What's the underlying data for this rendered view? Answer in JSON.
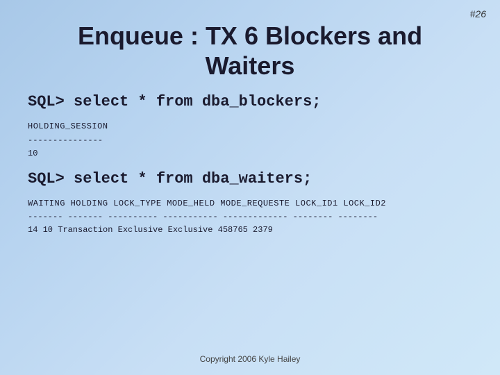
{
  "slide": {
    "number": "#26",
    "title_line1": "Enqueue : TX 6 Blockers and",
    "title_line2": "Waiters",
    "sql1": "SQL> select * from dba_blockers;",
    "col1_header": "HOLDING_SESSION",
    "col1_divider": "---------------",
    "col1_value": "10",
    "sql2": "SQL> select * from dba_waiters;",
    "col2_header": "WAITING HOLDING LOCK_TYPE   MODE_HELD   MODE_REQUESTE LOCK_ID1 LOCK_ID2",
    "col2_divider": "------- ------- ---------- ----------- ------------- -------- --------",
    "col2_row": "     14      10 Transaction Exclusive   Exclusive          458765     2379",
    "copyright": "Copyright 2006 Kyle Hailey"
  }
}
